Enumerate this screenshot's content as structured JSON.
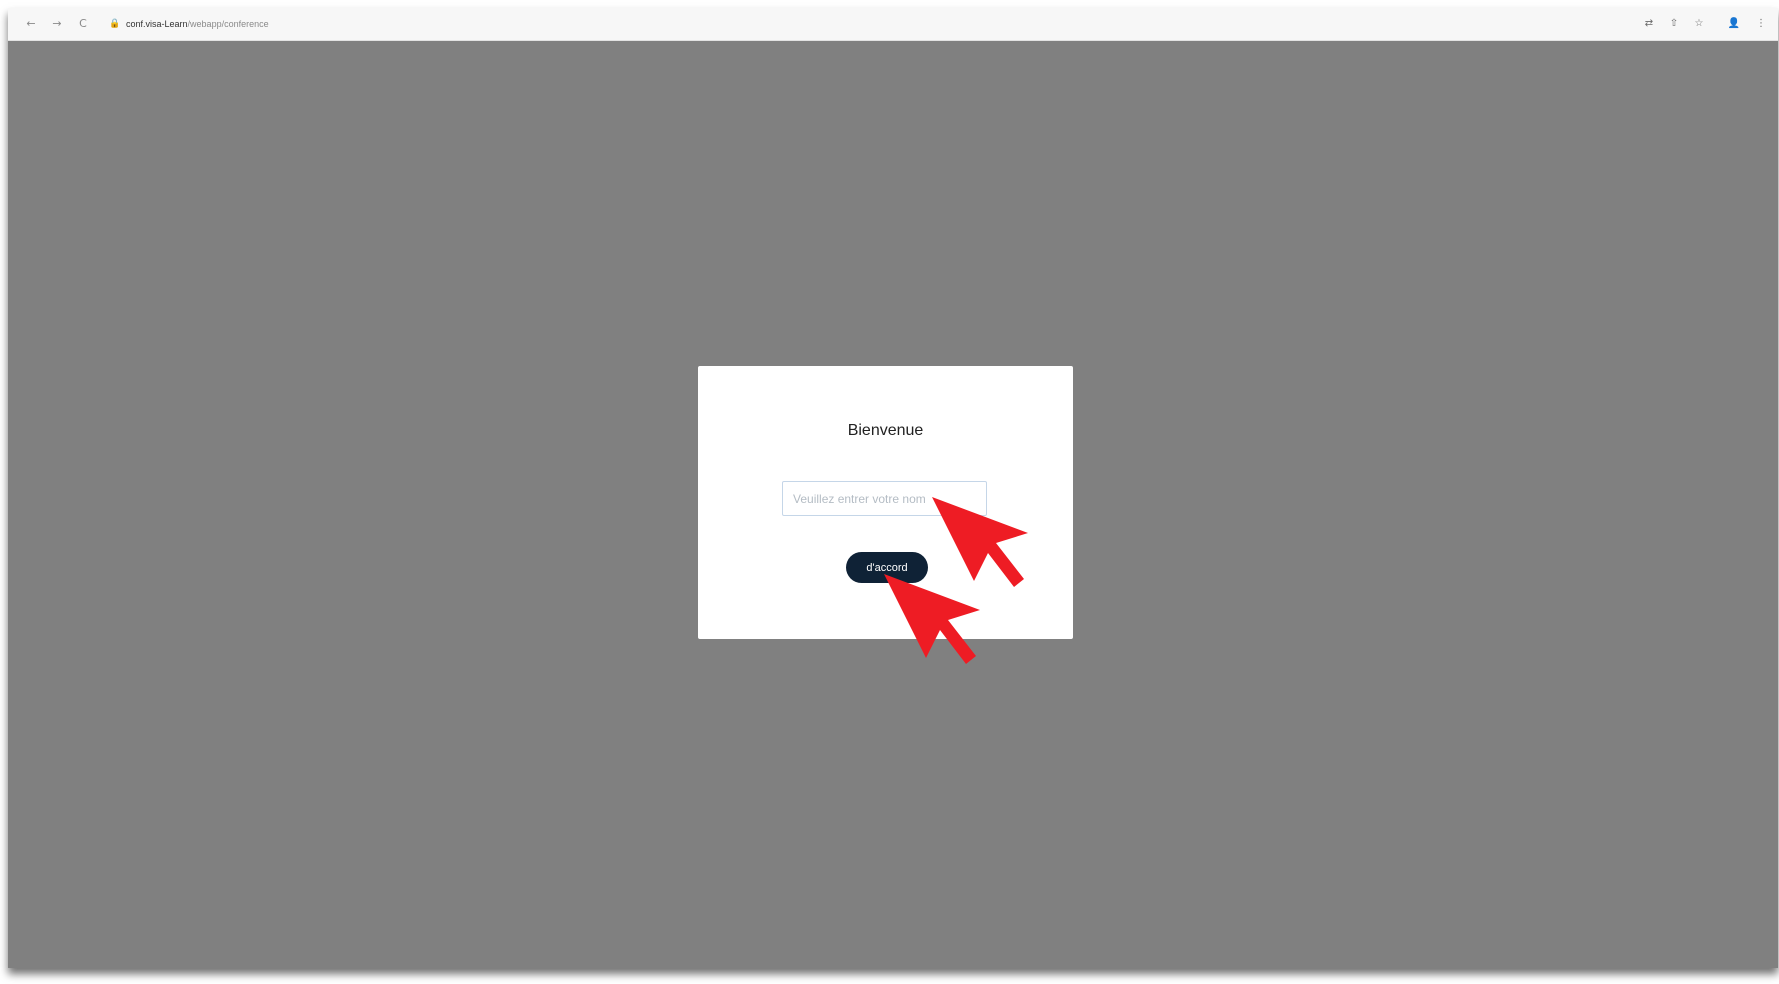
{
  "browser": {
    "back_icon": "←",
    "forward_icon": "→",
    "reload_icon": "C",
    "lock_icon": "🔒",
    "url_host": "conf.visa-Learn",
    "url_path": "/webapp/conference",
    "toolbar_icons": [
      "translate-icon",
      "share-icon",
      "star-icon",
      "profile-icon",
      "menu-icon"
    ],
    "toolbar_glyphs": [
      "⇄",
      "⇧",
      "☆",
      "👤",
      "⋮"
    ]
  },
  "modal": {
    "title": "Bienvenue",
    "input_placeholder": "Veuillez entrer votre nom",
    "button_label": "d'accord"
  },
  "colors": {
    "overlay": "#808080",
    "button_bg": "#0f2236",
    "annotation_arrow": "#ee1c24"
  }
}
